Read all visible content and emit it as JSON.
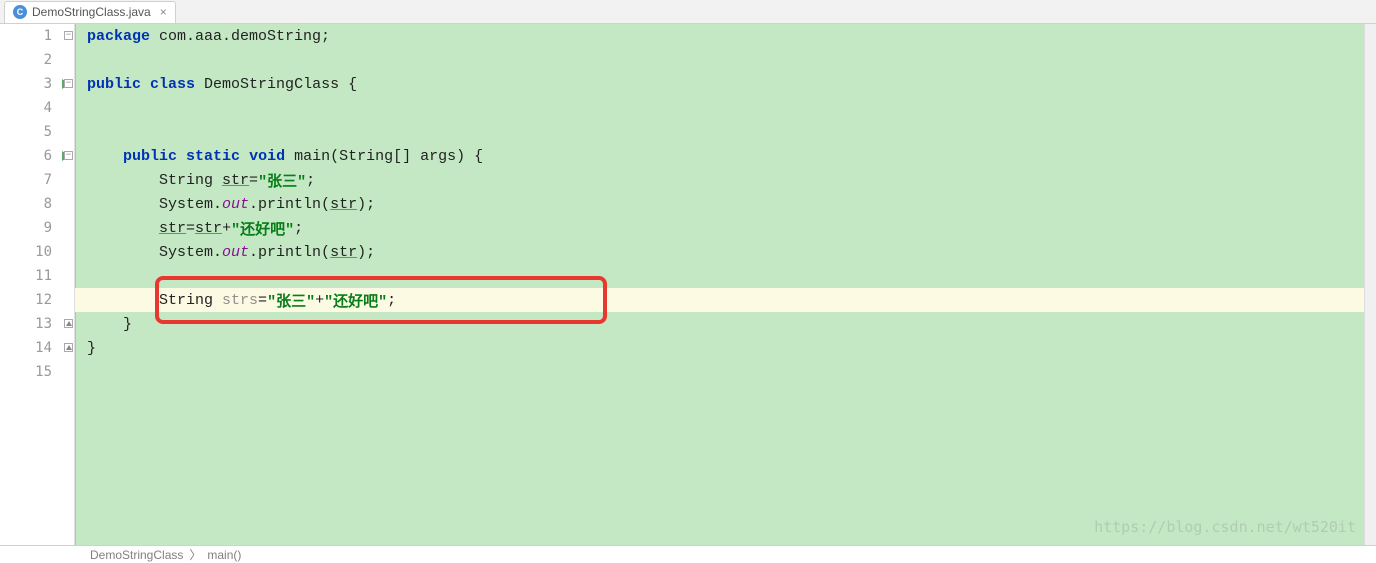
{
  "tab": {
    "title": "DemoStringClass.java",
    "icon_letter": "C"
  },
  "lines": [
    1,
    2,
    3,
    4,
    5,
    6,
    7,
    8,
    9,
    10,
    11,
    12,
    13,
    14,
    15
  ],
  "run_markers": [
    3,
    6
  ],
  "highlighted_line": 12,
  "code": {
    "l1": {
      "kw1": "package",
      "rest": " com.aaa.demoString;"
    },
    "l3": {
      "kw1": "public",
      "kw2": "class",
      "name": " DemoStringClass ",
      "brace": "{"
    },
    "l6": {
      "kw1": "public",
      "kw2": "static",
      "kw3": "void",
      "name": " main",
      "params": "(String[] args) ",
      "brace": "{"
    },
    "l7": {
      "indent": "        ",
      "type": "String ",
      "var": "str",
      "eq": "=",
      "str": "\"张三\"",
      "semi": ";"
    },
    "l8": {
      "indent": "        ",
      "obj": "System.",
      "out": "out",
      "method": ".println(",
      "var": "str",
      "close": ");"
    },
    "l9": {
      "indent": "        ",
      "var1": "str",
      "eq": "=",
      "var2": "str",
      "plus": "+",
      "str": "\"还好吧\"",
      "semi": ";"
    },
    "l10": {
      "indent": "        ",
      "obj": "System.",
      "out": "out",
      "method": ".println(",
      "var": "str",
      "close": ");"
    },
    "l12": {
      "indent": "        ",
      "type": "String ",
      "var": "strs",
      "eq": "=",
      "str1": "\"张三\"",
      "plus": "+",
      "str2": "\"还好吧\"",
      "semi": ";"
    },
    "l13": {
      "indent": "    ",
      "brace": "}"
    },
    "l14": {
      "brace": "}"
    }
  },
  "breadcrumb": {
    "class": "DemoStringClass",
    "method": "main()"
  },
  "watermark": "https://blog.csdn.net/wt520it"
}
